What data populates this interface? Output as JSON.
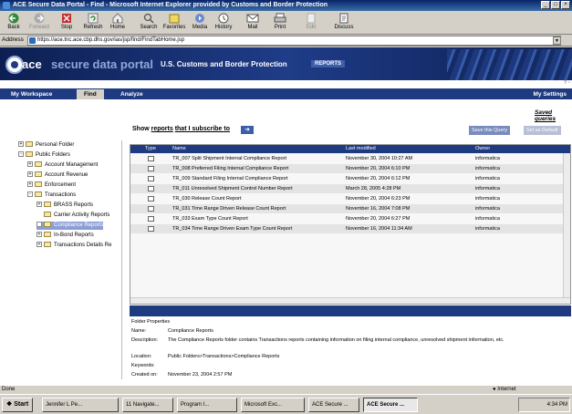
{
  "window": {
    "title": "ACE Secure Data Portal - Find - Microsoft Internet Explorer provided by Customs and Border Protection",
    "controls": [
      "_",
      "□",
      "×"
    ]
  },
  "toolbar": {
    "buttons": [
      {
        "label": "Back",
        "icon": "back-arrow-icon",
        "enabled": true
      },
      {
        "label": "Forward",
        "icon": "forward-arrow-icon",
        "enabled": false
      },
      {
        "label": "Stop",
        "icon": "stop-icon",
        "enabled": true
      },
      {
        "label": "Refresh",
        "icon": "refresh-icon",
        "enabled": true
      },
      {
        "label": "Home",
        "icon": "home-icon",
        "enabled": true
      },
      {
        "label": "Search",
        "icon": "search-icon",
        "enabled": true
      },
      {
        "label": "Favorites",
        "icon": "favorites-icon",
        "enabled": true
      },
      {
        "label": "Media",
        "icon": "media-icon",
        "enabled": true
      },
      {
        "label": "History",
        "icon": "history-icon",
        "enabled": true
      },
      {
        "label": "Mail",
        "icon": "mail-icon",
        "enabled": true
      },
      {
        "label": "Print",
        "icon": "print-icon",
        "enabled": true
      },
      {
        "label": "Edit",
        "icon": "edit-icon",
        "enabled": false
      },
      {
        "label": "Discuss",
        "icon": "discuss-icon",
        "enabled": true
      }
    ]
  },
  "address": {
    "label": "Address",
    "url": "https://ace.tnc.ace.cbp.dhs.gov/ias/jsp/find/FindTabHome.jsp"
  },
  "banner": {
    "brand_ace": "ace",
    "brand_rest": "secure data portal",
    "agency": "U.S. Customs and Border Protection",
    "reports_tag": "REPORTS"
  },
  "tabs": {
    "items": [
      "My Workspace",
      "Find",
      "Analyze"
    ],
    "active": "Find",
    "settings": "My Settings"
  },
  "find": {
    "saved_query": "Saved queries",
    "show_prefix": "Show",
    "show_reports": "reports",
    "show_middle": "that I subscribe to",
    "save_query_button": "Save this Query",
    "set_default_button": "Set as Default"
  },
  "tree": [
    {
      "label": "Personal Folder",
      "level": 0,
      "exp": "+"
    },
    {
      "label": "Public Folders",
      "level": 0,
      "exp": "-"
    },
    {
      "label": "Account Management",
      "level": 1,
      "exp": "+"
    },
    {
      "label": "Account Revenue",
      "level": 1,
      "exp": "+"
    },
    {
      "label": "Enforcement",
      "level": 1,
      "exp": "+"
    },
    {
      "label": "Transactions",
      "level": 1,
      "exp": "-"
    },
    {
      "label": "BRASS Reports",
      "level": 2,
      "exp": "+"
    },
    {
      "label": "Carrier Activity Reports",
      "level": 2,
      "exp": ""
    },
    {
      "label": "Compliance Reports",
      "level": 2,
      "exp": "+",
      "selected": true
    },
    {
      "label": "In-Bond Reports",
      "level": 2,
      "exp": "+"
    },
    {
      "label": "Transactions Details Re",
      "level": 2,
      "exp": "+"
    }
  ],
  "grid": {
    "columns": [
      "Type",
      "Name",
      "Last modified",
      "Owner"
    ],
    "rows": [
      {
        "name": "TR_007 Split Shipment Internal Compliance Report",
        "modified": "November 30, 2004 10:27 AM",
        "owner": "informatica"
      },
      {
        "name": "TR_008 Preferred Filing Internal Compliance Report",
        "modified": "November 20, 2004 6:10 PM",
        "owner": "informatica"
      },
      {
        "name": "TR_009 Standard Filing Internal Compliance Report",
        "modified": "November 20, 2004 6:12 PM",
        "owner": "informatica"
      },
      {
        "name": "TR_011 Unresolved Shipment Control Number Report",
        "modified": "March 28, 2005 4:28 PM",
        "owner": "informatica"
      },
      {
        "name": "TR_030 Release Count Report",
        "modified": "November 20, 2004 6:23 PM",
        "owner": "informatica"
      },
      {
        "name": "TR_031 Time Range Driven Release Count Report",
        "modified": "November 16, 2004 7:08 PM",
        "owner": "informatica"
      },
      {
        "name": "TR_033 Exam Type Count Report",
        "modified": "November 20, 2004 6:27 PM",
        "owner": "informatica"
      },
      {
        "name": "TR_034 Time Range Driven Exam Type Count Report",
        "modified": "November 16, 2004 11:34 AM",
        "owner": "informatica"
      }
    ]
  },
  "properties": {
    "title": "Folder Properties",
    "name_label": "Name:",
    "name": "Compliance Reports",
    "desc_label": "Description:",
    "desc": "The Compliance Reports folder contains Transactions reports containing information on filing internal compliance, unresolved shipment information, etc.",
    "location_label": "Location:",
    "location": "Public Folders>Transactions>Compliance Reports",
    "keywords_label": "Keywords:",
    "keywords": "",
    "created_label": "Created on:",
    "created": "November 23, 2004 2:57 PM"
  },
  "status": {
    "left": "Done",
    "zone": "Internet"
  },
  "taskbar": {
    "start": "Start",
    "tasks": [
      "Jennifer L Pe...",
      "11 Navigate...",
      "Program I...",
      "Microsoft Exc...",
      "ACE Secure ...",
      "ACE Secure ..."
    ],
    "active_index": 5,
    "clock": "4:34 PM"
  }
}
